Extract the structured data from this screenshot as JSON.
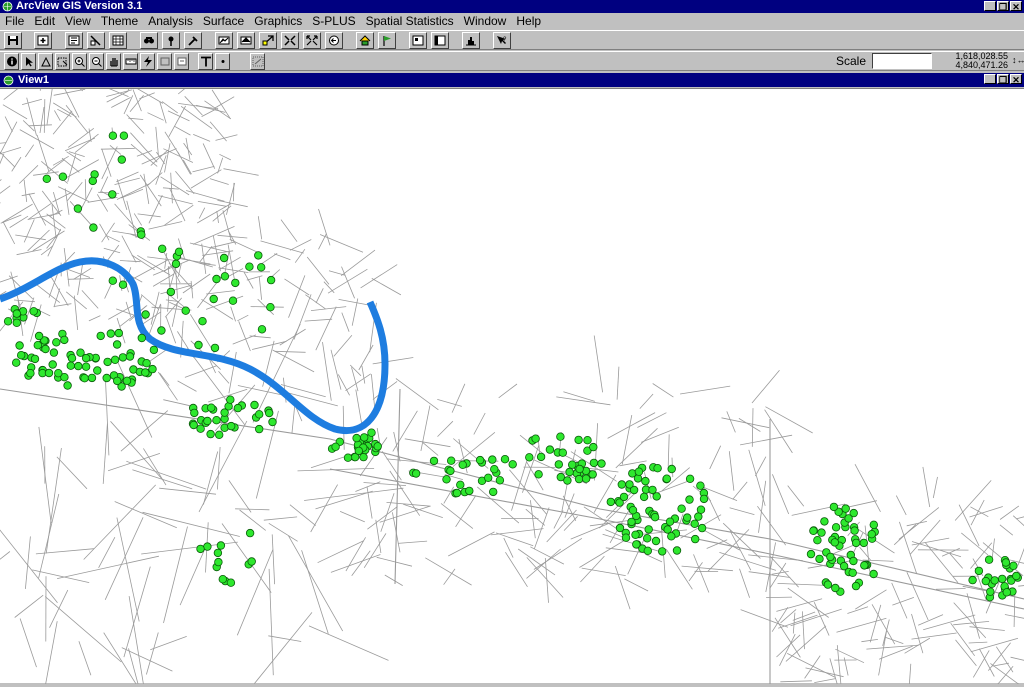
{
  "app": {
    "title": "ArcView GIS Version 3.1",
    "window_buttons": [
      "_",
      "❐",
      "✕"
    ]
  },
  "menu": {
    "items": [
      "File",
      "Edit",
      "View",
      "Theme",
      "Analysis",
      "Surface",
      "Graphics",
      "S-PLUS",
      "Spatial Statistics",
      "Window",
      "Help"
    ]
  },
  "toolbar2": {
    "scale_label": "Scale",
    "scale_value": "",
    "coord_x": "1,618,028.55",
    "coord_y": "4,840,471.26",
    "coord_icon": "↕↔"
  },
  "view": {
    "title": "View1",
    "window_buttons": [
      "_",
      "❐",
      "✕"
    ]
  },
  "colors": {
    "title_bar": "#000080",
    "chrome": "#c0c0c0",
    "river": "#1e7de0",
    "points_fill": "#2ee82e",
    "points_stroke": "#0a5a0a",
    "roads": "#9a9a9a"
  },
  "icons": {
    "toolbar1": [
      "save-icon",
      "add-theme-icon",
      "theme-properties-icon",
      "edit-legend-icon",
      "table-icon",
      "find-icon",
      "locate-address-icon",
      "query-builder-icon",
      "zoom-full-extent-icon",
      "zoom-to-themes-icon",
      "zoom-to-selected-icon",
      "zoom-in-icon",
      "zoom-out-icon",
      "zoom-previous-icon",
      "select-by-theme-icon",
      "clear-selection-icon",
      "help-icon"
    ],
    "toolbar2": [
      "identify-icon",
      "pointer-icon",
      "vertex-edit-icon",
      "select-feature-icon",
      "zoom-in-tool-icon",
      "zoom-out-tool-icon",
      "pan-icon",
      "measure-icon",
      "hotlink-icon",
      "area-of-interest-icon",
      "label-icon",
      "text-icon",
      "draw-point-icon",
      "snap-icon"
    ]
  }
}
